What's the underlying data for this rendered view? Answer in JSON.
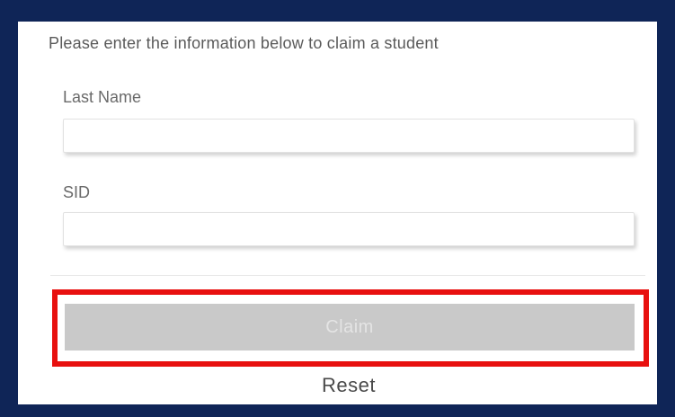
{
  "form": {
    "intro_text": "Please enter the information below to claim a student",
    "last_name": {
      "label": "Last Name",
      "value": "",
      "placeholder": ""
    },
    "sid": {
      "label": "SID",
      "value": "",
      "placeholder": ""
    },
    "claim_button": {
      "label": "Claim",
      "state": "disabled"
    },
    "reset_label": "Reset"
  },
  "colors": {
    "frame_border": "#0f2557",
    "highlight_outline": "#e8100f",
    "button_disabled_bg": "#c9c9c9"
  }
}
